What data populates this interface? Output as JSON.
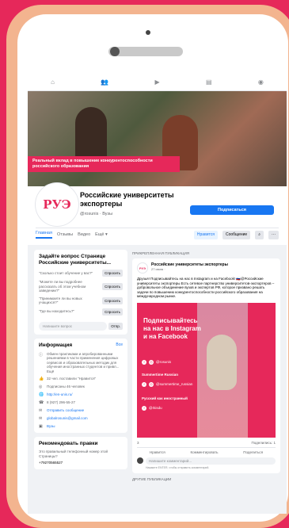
{
  "nav": {
    "icons": [
      "home-icon",
      "people-icon",
      "video-icon",
      "store-icon",
      "groups-icon"
    ]
  },
  "cover": {
    "caption": "Реальный вклад в повышение конкурентоспособности российского образования"
  },
  "page": {
    "logo_text": "РУЭ",
    "name": "Российские университеты экспортеры",
    "handle": "@rosunis · Вузы",
    "subscribe_label": "Подписаться"
  },
  "tabs": {
    "items": [
      "Главная",
      "Отзывы",
      "Видео",
      "Ещё ▾"
    ],
    "like": "Нравится",
    "message": "Сообщение",
    "search": "⌕",
    "more": "···"
  },
  "questions": {
    "title": "Задайте вопрос Странице Российские университеты...",
    "items": [
      {
        "text": "\"Сколько стоит обучение у вас?\"",
        "btn": "Спросить"
      },
      {
        "text": "\"Можете ли вы подробнее рассказать об этом учебном заведении?\"",
        "btn": "Спросить"
      },
      {
        "text": "\"Принимаете ли вы новых учащихся?\"",
        "btn": "Спросить"
      },
      {
        "text": "\"Где вы находитесь?\"",
        "btn": "Спросить"
      }
    ],
    "input_placeholder": "Напишите вопрос",
    "send": "Отпр."
  },
  "info": {
    "title": "Информация",
    "all": "Все",
    "about": "Обмен практиками и апробированными решениями в части применения цифровых сервисов и образовательных методик для обучения иностранных студентов и привл... Ещё",
    "likes": "32 чел. поставили \"Нравится\"",
    "followers": "Подписаны 46 человек",
    "site": "http://en-unis.ru/",
    "phone": "8 (927) 296-55-27",
    "message": "Отправить сообщение",
    "email": "globalrosunis@gmail.com",
    "category": "Вузы"
  },
  "edits": {
    "title": "Рекомендовать правки",
    "question": "Это правильный телефонный номер этой Страницы?",
    "value": "+79270565527"
  },
  "pinned": {
    "label": "ПРИКРЕПЛЕННАЯ ПУБЛИКАЦИЯ",
    "author": "Российские университеты экспортеры",
    "date": "27 июля · ",
    "text": "Друзья! Подписывайтесь на нас в Instagram и на Facebook! 🇷🇺@Российские университеты экспортеры Есть сетевое партнерство университетов-экспортеров – добровольное объединение вузов и экспертов РФ, которое призвано решать задачи по повышению конкурентоспособности российского образования на международном рынке.",
    "promo_title": "Подписывайтесь на нас в Instagram и на Facebook",
    "promo": [
      {
        "icon": "f",
        "text": ""
      },
      {
        "icon": "◎",
        "text": "@rosunis"
      },
      {
        "label": "Summertime Russian"
      },
      {
        "icon": "f",
        "text": ""
      },
      {
        "icon": "◎",
        "text": "@summertime_russian"
      },
      {
        "label": "Русский как иностранный"
      },
      {
        "icon": "f",
        "text": "@rkisdu"
      }
    ],
    "reactions": "3",
    "shares": "Поделились: 1",
    "actions": [
      "Нравится",
      "Комментировать",
      "Поделиться"
    ],
    "comment_placeholder": "Напишите комментарий...",
    "comment_hint": "Нажмите ENTER, чтобы отправить комментарий."
  },
  "other": {
    "label": "ДРУГИЕ ПУБЛИКАЦИИ"
  },
  "colors": {
    "brand": "#e6285a",
    "fb_blue": "#1877f2",
    "phone": "#f3b48f"
  }
}
